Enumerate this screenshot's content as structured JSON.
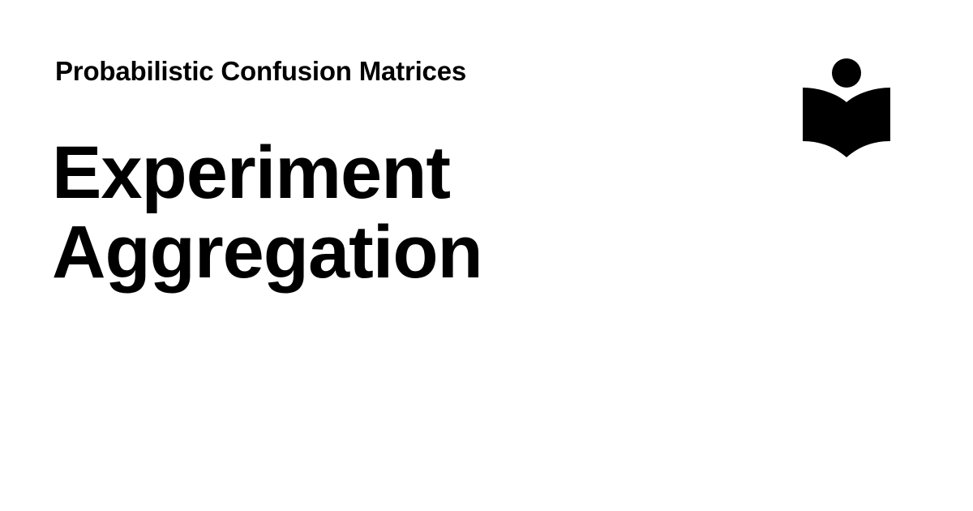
{
  "card": {
    "subtitle": "Probabilistic Confusion Matrices",
    "title_lines": [
      "Experiment",
      "Aggregation"
    ]
  },
  "logo": {
    "icon": "reading-person-book-icon",
    "color": "#000000"
  },
  "colors": {
    "background": "#ffffff",
    "text": "#000000"
  }
}
